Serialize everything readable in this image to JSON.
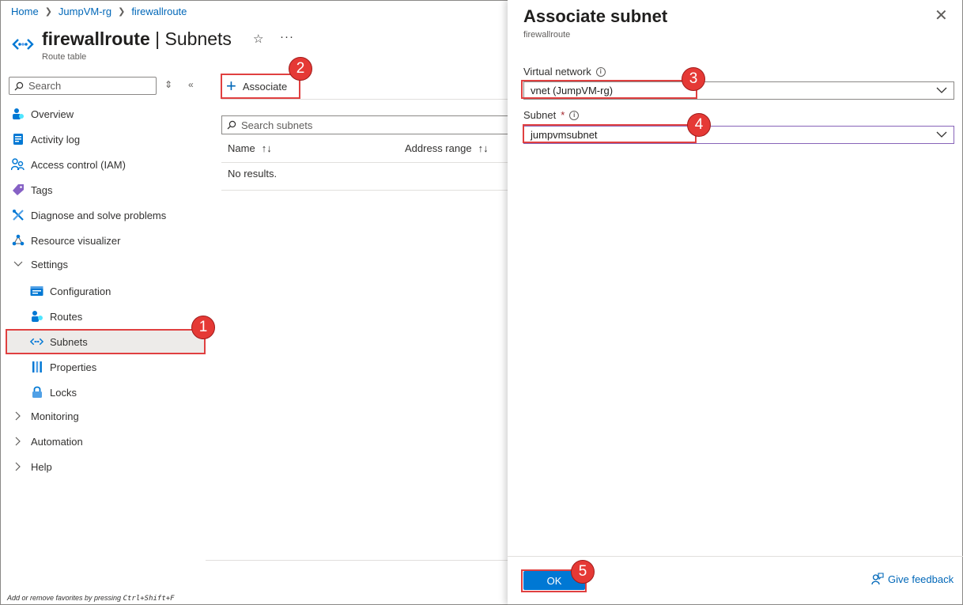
{
  "breadcrumb": [
    {
      "label": "Home"
    },
    {
      "label": "JumpVM-rg"
    },
    {
      "label": "firewallroute"
    }
  ],
  "header": {
    "title_resource": "firewallroute",
    "title_separator": "|",
    "title_section": "Subnets",
    "subtitle": "Route table",
    "more_label": "···"
  },
  "sidebar": {
    "search_placeholder": "Search",
    "items": [
      {
        "label": "Overview",
        "icon": "overview-icon"
      },
      {
        "label": "Activity log",
        "icon": "activity-log-icon"
      },
      {
        "label": "Access control (IAM)",
        "icon": "iam-icon"
      },
      {
        "label": "Tags",
        "icon": "tag-icon"
      },
      {
        "label": "Diagnose and solve problems",
        "icon": "wrench-icon"
      },
      {
        "label": "Resource visualizer",
        "icon": "visualizer-icon"
      }
    ],
    "settings_group": {
      "label": "Settings",
      "children": [
        {
          "label": "Configuration",
          "icon": "configuration-icon"
        },
        {
          "label": "Routes",
          "icon": "routes-icon"
        },
        {
          "label": "Subnets",
          "icon": "subnets-icon"
        },
        {
          "label": "Properties",
          "icon": "properties-icon"
        },
        {
          "label": "Locks",
          "icon": "lock-icon"
        }
      ]
    },
    "collapsed_groups": [
      {
        "label": "Monitoring"
      },
      {
        "label": "Automation"
      },
      {
        "label": "Help"
      }
    ],
    "favorites_hint_prefix": "Add or remove favorites by pressing ",
    "favorites_hint_keys": "Ctrl+Shift+F"
  },
  "main": {
    "associate_label": "Associate",
    "search_placeholder": "Search subnets",
    "columns": [
      {
        "label": "Name"
      },
      {
        "label": "Address range"
      }
    ],
    "empty_message": "No results."
  },
  "blade": {
    "title": "Associate subnet",
    "subtitle": "firewallroute",
    "virtual_network": {
      "label": "Virtual network",
      "value": "vnet (JumpVM-rg)"
    },
    "subnet": {
      "label": "Subnet",
      "required_mark": "*",
      "value": "jumpvmsubnet"
    },
    "ok_label": "OK",
    "feedback_label": "Give feedback"
  },
  "callouts": [
    "1",
    "2",
    "3",
    "4",
    "5"
  ],
  "colors": {
    "accent": "#0078d4",
    "link": "#0067b8",
    "callout": "#e53935",
    "selected_bg": "#edebe9"
  }
}
